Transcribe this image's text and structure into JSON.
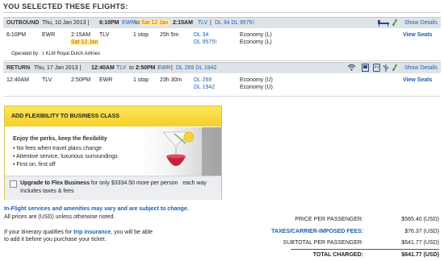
{
  "page": {
    "title": "YOU SELECTED THESE FLIGHTS:"
  },
  "outbound": {
    "label": "OUTBOUND",
    "date_info": "Thu, 10 Jan 2013 |",
    "dep_time": "6:10PM",
    "dep_airport": "EWR",
    "to_text": "to",
    "arr_date": "Sat 12 Jan",
    "arr_time": "2:15AM",
    "arr_airport": "TLV",
    "sep": "|",
    "flights_summary": "DL 34 DL 9575",
    "flights_summary_fn": "1",
    "show_details": "Show Details",
    "row": {
      "dep_time": "6:10PM",
      "dep_airport": "EWR",
      "arr_time": "2:15AM",
      "arr_date": "Sat 12 Jan",
      "arr_airport": "TLV",
      "stops": "1 stop",
      "duration": "25h 5m",
      "flight1": "DL 34",
      "flight2": "DL 9575",
      "flight2_fn": "1",
      "cabin1": "Economy (L)",
      "cabin2": "Economy (L)",
      "view_seats": "View Seats"
    },
    "operated_by_label": "Operated by:",
    "operated_by_fn": "1",
    "operated_by_value": "KLM Royal Dutch Airlines",
    "amenity_icons": [
      "flat-bed-icon",
      "fresh-food-icon"
    ]
  },
  "return": {
    "label": "RETURN",
    "date_info": "Thu, 17 Jan 2013 |",
    "dep_time": "12:40AM",
    "dep_airport": "TLV",
    "to_text": "to",
    "arr_time": "2:50PM",
    "arr_airport": "EWR",
    "sep": "|",
    "flights_summary": "DL 269 DL 1942",
    "show_details": "Show Details",
    "row": {
      "dep_time": "12:40AM",
      "dep_airport": "TLV",
      "arr_time": "2:50PM",
      "arr_airport": "EWR",
      "stops": "1 stop",
      "duration": "23h 30m",
      "flight1": "DL 269",
      "flight2": "DL 1942",
      "cabin1": "Economy (U)",
      "cabin2": "Economy (U)",
      "view_seats": "View Seats"
    },
    "amenity_icons": [
      "wifi-icon",
      "video-icon",
      "power-outlet-icon",
      "usb-icon",
      "fresh-food-icon"
    ]
  },
  "upgrade": {
    "header": "ADD FLEXIBILITY TO BUSINESS CLASS",
    "perks_title": "Enjoy the perks, keep the flexibility",
    "bullets": [
      "No fees when travel plans change",
      "Attentive service, luxurious surroundings",
      "First on, first off"
    ],
    "checkbox_label_bold": "Upgrade to Flex Business",
    "checkbox_label_mid": "for only",
    "checkbox_price": "$3334.50",
    "checkbox_label_tail": "more per person   each way",
    "checkbox_label_line2": "Includes taxes & fees"
  },
  "notes": {
    "amenities_notice": "In-Flight services and amenities may vary and are subject to change.",
    "currency_notice": "All prices are (USD) unless otherwise noted.",
    "insurance_pre": "If your itinerary qualifies for",
    "insurance_link": "trip insurance",
    "insurance_post": ", you will be able",
    "insurance_line2": "to add it before you purchase your ticket."
  },
  "pricing": {
    "price_per_passenger_label": "PRICE PER PASSENGER:",
    "price_per_passenger_value": "$565.40 (USD)",
    "taxes_label": "TAXES/CARRIER-IMPOSED FEES:",
    "taxes_value": "$76.37 (USD)",
    "subtotal_label": "SUBTOTAL PER PASSENGER:",
    "subtotal_value": "$641.77 (USD)",
    "total_label": "TOTAL CHARGED:",
    "total_value": "$641.77 (USD)"
  },
  "colors": {
    "link": "#1a5fb4",
    "highlight": "#ffef9e",
    "header_bg": "#dfe3e8",
    "upgrade_header": "#f5cf2a"
  }
}
